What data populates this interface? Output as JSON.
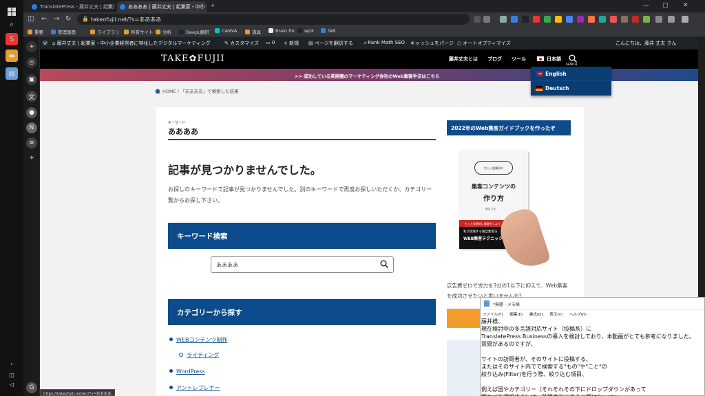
{
  "browser": {
    "tabs": [
      {
        "title": "TranslatePress - 藤井丈夫 | 起業家"
      },
      {
        "title": "ああああ | 藤井丈夫 | 起業家・中小"
      }
    ],
    "url": "takeofujii.net/?s=ああああ",
    "bookmarks": [
      "重要",
      "管理画面",
      "ライブラリ",
      "所有サイト",
      "分析",
      "DeepL翻訳",
      "CANVA",
      "道具",
      "Brain.fm",
      "wpX",
      "TaB"
    ]
  },
  "wp_admin_bar": {
    "site_name": "藤井丈夫 | 起業家・中小企業経営者に特化したデジタルマーケティング",
    "customize": "カスタマイズ",
    "comments": "0",
    "new": "+ 新規",
    "translate": "ページを翻訳する",
    "rankmath": "Rank Math SEO",
    "purge": "キャッシュをパージ",
    "autoptimize": "オートオプティマイズ",
    "greeting": "こんにちは、藤井 丈夫 さん"
  },
  "site": {
    "logo": "TAKE✿FUJII",
    "nav": [
      "藤井丈夫とは",
      "ブログ",
      "ツール",
      "日本語"
    ],
    "search_label": "SEARCH",
    "banner": ">> 成功している英語圏のマーケティング会社のWeb集客手法はこちら",
    "languages": [
      "English",
      "Deutsch"
    ],
    "breadcrumb_home": "HOME",
    "breadcrumb_current": "「ああああ」で検索した結果"
  },
  "main": {
    "keyword_label": "キーワード",
    "keyword_value": "ああああ",
    "not_found_title": "記事が見つかりませんでした。",
    "not_found_desc": "お探しのキーワードで記事が見つかりませんでした。別のキーワードで再度お探しいただくか、カテゴリー覧からお探し下さい。",
    "search_heading": "キーワード検索",
    "search_value": "ああああ",
    "category_heading": "カテゴリーから探す",
    "categories": [
      "WEBコンテンツ制作",
      "ライティング",
      "WordPress",
      "アントレプレナー"
    ]
  },
  "sidebar": {
    "title": "2022年のWeb集客ガイドブックを作ったぞ",
    "book_badge": "忙しい起業家の",
    "book_title_1": "集客コンテンツの",
    "book_title_2": "作り方",
    "book_author": "藤井 丈夫",
    "book_strip": "もっと効率的に集客をしよう",
    "book_strip2_1": "私が実践する独自集客法",
    "book_strip2_2": "WEB集客テクニック",
    "text": "広告費ゼロで労力を3分の1以下に抑えて、Web集客を成功させたいと思いませんか？"
  },
  "status_url": "https://takeofujii.net/en/?s=ああああ",
  "notepad": {
    "title": "*無題 - メモ帳",
    "menu": [
      "ファイル(F)",
      "編集(E)",
      "書式(O)",
      "表示(V)",
      "ヘルプ(H)"
    ],
    "body": "藤井様、\n現在検討中の多言語対応サイト（投稿系）に\nTranslatePress Businessの導入を検討しており、本動画がとても参考になりました。\n質問があるのですが、\n\nサイトの訪問者が、そのサイトに投稿する、\nまたはそのサイト内でで検索する\"もの\"や\"こと\"の\n絞り込み(Filter)を行う際、絞り込む項目、\n\n例えば国やカテゴリー（それぞれその下にドロップダウンがあって\n国などを選択する）は、英語表示にすると国はCountry、"
  }
}
